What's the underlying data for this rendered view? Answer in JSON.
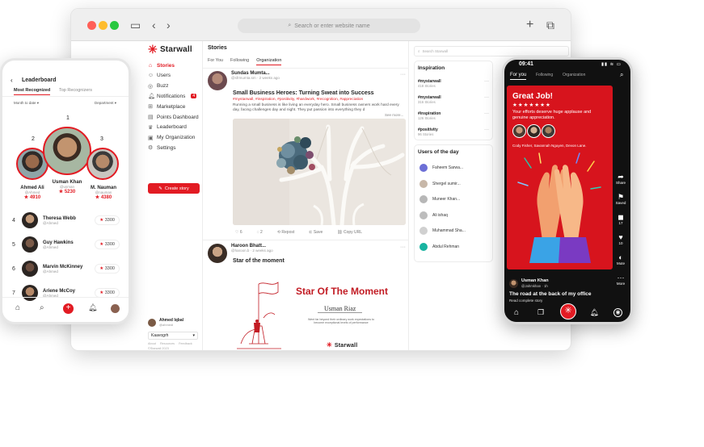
{
  "browser": {
    "url_placeholder": "Search or enter website name",
    "brand": "Starwall",
    "sidebar": {
      "items": [
        {
          "label": "Stories",
          "icon": "home-icon",
          "active": true
        },
        {
          "label": "Users",
          "icon": "users-icon"
        },
        {
          "label": "Buzz",
          "icon": "buzz-icon"
        },
        {
          "label": "Notifications",
          "icon": "bell-icon",
          "badge": "4"
        },
        {
          "label": "Marketplace",
          "icon": "store-icon"
        },
        {
          "label": "Points Dashboard",
          "icon": "chart-icon"
        },
        {
          "label": "Leaderboard",
          "icon": "trophy-icon"
        },
        {
          "label": "My Organization",
          "icon": "org-icon"
        },
        {
          "label": "Settings",
          "icon": "gear-icon"
        }
      ],
      "create_story": "Create story",
      "profile_name": "Ahmed Iqbal",
      "profile_handle": "@ahmedi",
      "workspace": "Kaavogrh",
      "footer_links": [
        "About",
        "Resources",
        "Feedback"
      ],
      "copyright": "©Starwall 2023"
    },
    "feed": {
      "heading": "Stories",
      "tabs": [
        "For You",
        "Following",
        "Organization"
      ],
      "active_tab": "Organization",
      "post1": {
        "author": "Sundas Mumta...",
        "meta": "@sfrmumta.sm · 2 weeks ago",
        "title": "Small Business Heroes: Turning Sweat into Success",
        "hashtags": "#mystarwall, #inspiration, #positivity, #hardwork, #recognition, #appreciation",
        "body": "Running a small business is like living an everyday hero. Small business owners work hard every day, facing challenges day and night. They put passion into everything they d",
        "see_more": "See more...",
        "actions": [
          "6",
          "2",
          "Repost",
          "Save",
          "Copy URL"
        ]
      },
      "post2": {
        "author": "Haroon Bhatt...",
        "meta": "@haroon.b · 2 weeks ago",
        "title": "Star of the moment",
        "card_title": "Star Of The Moment",
        "card_name": "Usman Riaz",
        "card_text": "Went far beyond their ordinary work expectations to become exceptional levels of performance",
        "card_brand": "Starwall"
      }
    },
    "right": {
      "search_placeholder": "Search Starwall",
      "inspiration_title": "Inspiration",
      "inspiration": [
        {
          "tag": "#mystarwall",
          "sub": "418 Stories"
        },
        {
          "tag": "#mystarwall",
          "sub": "316 Stories"
        },
        {
          "tag": "#inspiration",
          "sub": "126 Stories"
        },
        {
          "tag": "#positivity",
          "sub": "96 Stories"
        }
      ],
      "users_title": "Users of the day",
      "users": [
        "Faheem Sarwa...",
        "Shergel sumir...",
        "Muneer Khan...",
        "Ali ishaq",
        "Muhammad Sha...",
        "Abdul Rehman"
      ]
    }
  },
  "left_phone": {
    "title": "Leaderboard",
    "tabs": [
      "Most Recognized",
      "Top Recognizers"
    ],
    "filter": "Month to date",
    "department": "Department",
    "podium": [
      {
        "rank": "2",
        "name": "Ahmed Ali",
        "handle": "@Ahmed",
        "points": "4910"
      },
      {
        "rank": "1",
        "name": "Usman Khan",
        "handle": "@usman",
        "points": "5230"
      },
      {
        "rank": "3",
        "name": "M. Nauman",
        "handle": "@nauman",
        "points": "4380"
      }
    ],
    "rows": [
      {
        "rank": "4",
        "name": "Theresa Webb",
        "handle": "@Ahmed",
        "points": "3300"
      },
      {
        "rank": "5",
        "name": "Guy Hawkins",
        "handle": "@Ahmed",
        "points": "3300"
      },
      {
        "rank": "6",
        "name": "Marvin McKinney",
        "handle": "@Ahmed",
        "points": "3300"
      },
      {
        "rank": "7",
        "name": "Ariene McCoy",
        "handle": "@Ahmed",
        "points": "3300"
      }
    ]
  },
  "right_phone": {
    "time": "09:41",
    "tabs": [
      "For you",
      "Following",
      "Organization"
    ],
    "card_title": "Great Job!",
    "stars": "★★★★★★★",
    "card_text": "Your efforts deserve huge applause and genuine appreciation.",
    "card_names": "Cody Fisher,  Savannah Nguyen,  Devon Lane.",
    "side_actions": [
      {
        "icon": "share-icon",
        "label": "Share"
      },
      {
        "icon": "saved-icon",
        "label": "Saved"
      },
      {
        "icon": "comment-icon",
        "label": "17"
      },
      {
        "icon": "like-icon",
        "label": "10"
      },
      {
        "icon": "mute-icon",
        "label": "Mute"
      },
      {
        "icon": "more-icon",
        "label": "More"
      }
    ],
    "author": "Usman Khan",
    "author_meta": "@Jahmkhan · 1h",
    "caption": "The road at the back of my office",
    "read_more": "Read complete story"
  },
  "colors": {
    "brand": "#e21b23",
    "dark": "#111111"
  }
}
